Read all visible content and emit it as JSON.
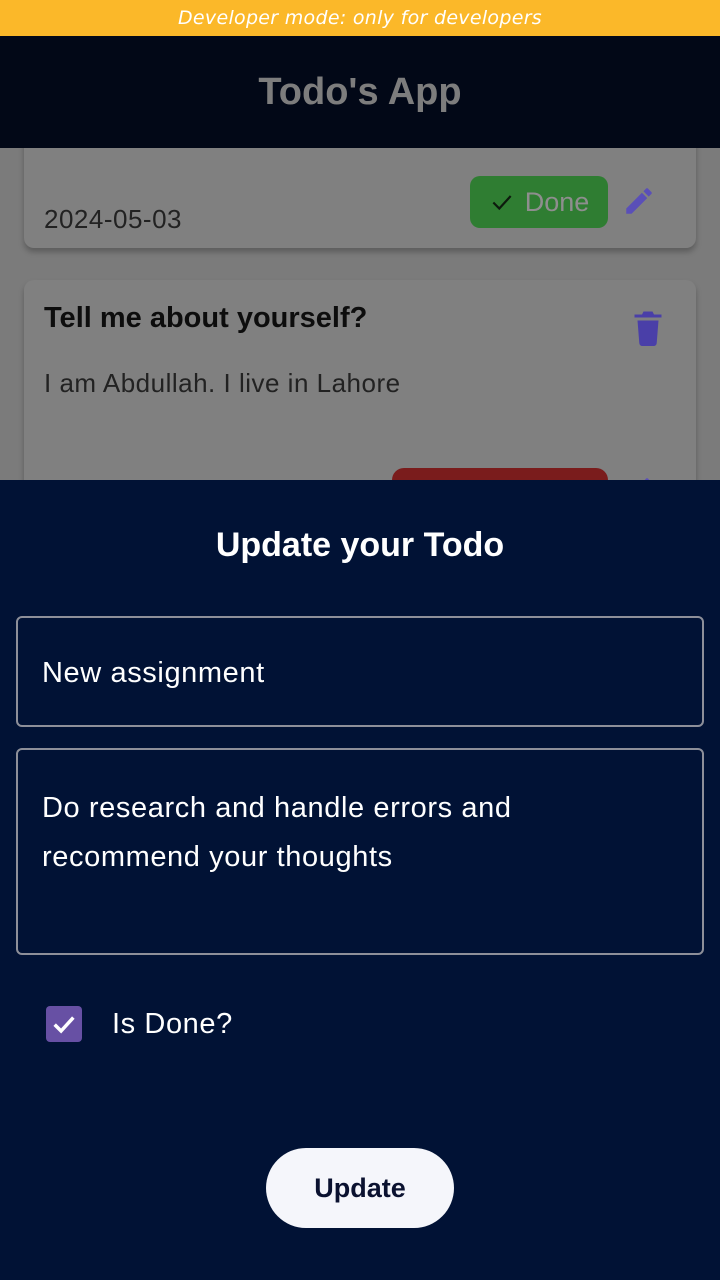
{
  "banner": {
    "text": "Developer mode: only for developers"
  },
  "app_bar": {
    "title": "Todo's App"
  },
  "todos": [
    {
      "date": "2024-05-03",
      "status_label": "Done",
      "status_color": "#2f7d32"
    },
    {
      "title": "Tell me about yourself?",
      "description": "I am Abdullah. I live in Lahore",
      "status_color": "#7a1c1c"
    }
  ],
  "sheet": {
    "title": "Update your Todo",
    "title_field_value": "New assignment",
    "description_field_value": "Do research and handle errors and recommend your thoughts",
    "checkbox_label": "Is Done?",
    "checkbox_checked": true,
    "update_label": "Update"
  },
  "colors": {
    "banner": "#fbb829",
    "app_bar": "#020817",
    "sheet": "#011235",
    "accent": "#6750a4",
    "icon": "#5a4fb8"
  }
}
